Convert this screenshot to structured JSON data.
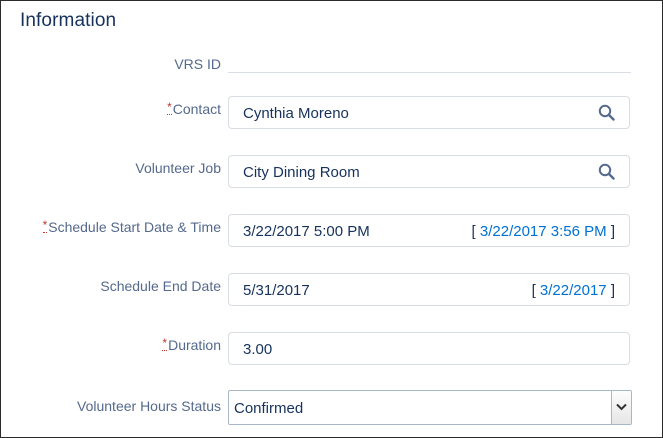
{
  "section": {
    "title": "Information"
  },
  "fields": {
    "vrs_id": {
      "label": "VRS ID"
    },
    "contact": {
      "label": "Contact",
      "required_marker": "*",
      "value": "Cynthia Moreno"
    },
    "volunteer_job": {
      "label": "Volunteer Job",
      "value": "City Dining Room"
    },
    "schedule_start": {
      "label": "Schedule Start Date & Time",
      "required_marker": "*",
      "value": "3/22/2017 5:00 PM",
      "hint_open": "[ ",
      "hint_link": "3/22/2017 3:56 PM",
      "hint_close": " ]"
    },
    "schedule_end": {
      "label": "Schedule End Date",
      "value": "5/31/2017",
      "hint_open": "[ ",
      "hint_link": "3/22/2017",
      "hint_close": " ]"
    },
    "duration": {
      "label": "Duration",
      "required_marker": "*",
      "value": "3.00"
    },
    "hours_status": {
      "label": "Volunteer Hours Status",
      "value": "Confirmed"
    }
  },
  "icons": {
    "lookup": "search-icon",
    "dropdown": "chevron-down-icon"
  },
  "colors": {
    "label": "#54698d",
    "value": "#16325c",
    "link": "#0070d2",
    "required": "#c23934",
    "border": "#d8dde6"
  }
}
